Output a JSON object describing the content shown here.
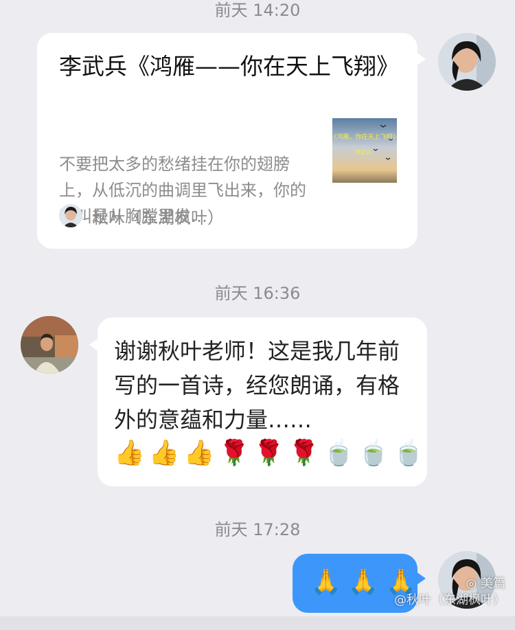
{
  "timestamps": [
    "前天 14:20",
    "前天 16:36",
    "前天 17:28"
  ],
  "share_card": {
    "title": "李武兵《鸿雁——你在天上飞翔》",
    "description": "不要把太多的愁绪挂在你的翅膀上，从低沉的曲调里飞出来，你的鸣叫是从胸膛里发…",
    "thumbnail_text_line1": "《鸿雁，你在天上飞翔》",
    "thumbnail_text_line2": "李武兵",
    "source_name": "秋叶（东湖枫叶）"
  },
  "message_left": {
    "text": "谢谢秋叶老师！这是我几年前写的一首诗，经您朗诵，有格外的意蕴和力量……",
    "emojis": [
      "👍",
      "👍",
      "👍",
      "🌹",
      "🌹",
      "🌹",
      "🍵",
      "🍵",
      "🍵"
    ]
  },
  "message_right": {
    "emojis": [
      "🙏",
      "🙏",
      "🙏"
    ]
  },
  "watermark": {
    "logo": "美篇",
    "handle": "@秋叶（东湖枫叶）"
  },
  "colors": {
    "background": "#ededf1",
    "bubble_white": "#ffffff",
    "bubble_blue": "#3d97fb",
    "timestamp": "#8a8a8f"
  }
}
